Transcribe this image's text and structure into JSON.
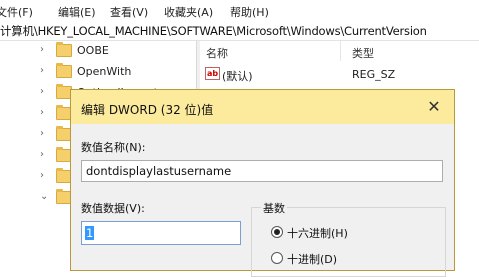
{
  "menu": {
    "items": [
      "文件(F)",
      "编辑(E)",
      "查看(V)",
      "收藏夹(A)",
      "帮助(H)"
    ]
  },
  "address": {
    "path": "计算机\\HKEY_LOCAL_MACHINE\\SOFTWARE\\Microsoft\\Windows\\CurrentVersion"
  },
  "tree": {
    "items": [
      {
        "label": "OOBE",
        "arrow": "›"
      },
      {
        "label": "OpenWith",
        "arrow": "›"
      },
      {
        "label": "OptimalLayout",
        "arrow": "›"
      },
      {
        "label": "",
        "arrow": "›"
      },
      {
        "label": "",
        "arrow": "›"
      },
      {
        "label": "",
        "arrow": "›"
      },
      {
        "label": "",
        "arrow": "›"
      },
      {
        "label": "",
        "arrow": "⌄"
      }
    ]
  },
  "list": {
    "header_name": "名称",
    "header_type": "类型",
    "rows": [
      {
        "icon": "ab",
        "name": "(默认)",
        "type": "REG_SZ"
      }
    ]
  },
  "dialog": {
    "title": "编辑 DWORD (32 位)值",
    "close_glyph": "✕",
    "name_label": "数值名称(N):",
    "name_value": "dontdisplaylastusername",
    "data_label": "数值数据(V):",
    "data_value": "1",
    "base_label": "基数",
    "radio_hex": "十六进制(H)",
    "radio_dec": "十进制(D)",
    "selected_base": "hex"
  },
  "colors": {
    "dialog_title_bg": "#fceb9c",
    "selection": "#3399ff",
    "folder": "#f4cf6c"
  }
}
